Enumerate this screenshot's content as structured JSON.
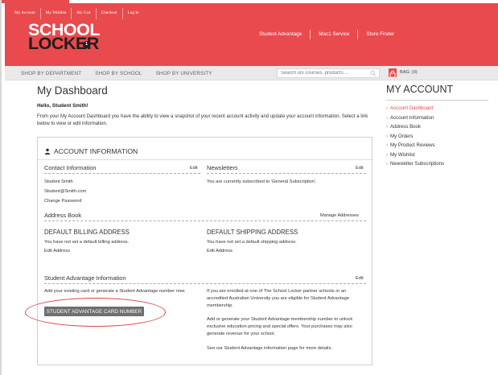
{
  "top_links": [
    "My Account",
    "My Wishlist",
    "My Cart",
    "Checkout",
    "Log In"
  ],
  "logo": {
    "line1": "SCHOOL",
    "line2": "LOCKER"
  },
  "header_nav": [
    "Student Advantage",
    "Mac1 Service",
    "Store Finder"
  ],
  "nav_tabs": [
    "SHOP BY DEPARTMENT",
    "SHOP BY SCHOOL",
    "SHOP BY UNIVERSITY"
  ],
  "search": {
    "placeholder": "Search uni courses, products ..."
  },
  "bag": {
    "label": "BAG: (0)"
  },
  "page": {
    "title": "My Dashboard",
    "greeting": "Hello, Student Smith!",
    "intro": "From your My Account Dashboard you have the ability to view a snapshot of your recent account activity and update your account information. Select a link below to view or edit information."
  },
  "account_info": {
    "heading": "ACCOUNT INFORMATION",
    "contact": {
      "title": "Contact Information",
      "edit": "Edit",
      "name": "Student Smith",
      "email": "Student@Smith.com",
      "change_password": "Change Password"
    },
    "newsletters": {
      "title": "Newsletters",
      "edit": "Edit",
      "text": "You are currently subscribed to 'General Subscription'."
    },
    "address_book": {
      "title": "Address Book",
      "manage": "Manage Addresses",
      "billing_title": "DEFAULT BILLING ADDRESS",
      "billing_text": "You have not set a default billing address.",
      "billing_edit": "Edit Address",
      "shipping_title": "DEFAULT SHIPPING ADDRESS",
      "shipping_text": "You have not set a default shipping address.",
      "shipping_edit": "Edit Address"
    },
    "student_advantage": {
      "title": "Student Advantage Information",
      "edit": "Edit",
      "left_text": "Add your existing card or generate a Student Advantage number now.",
      "button": "STUDENT ADVANTAGE CARD NUMBER",
      "right_p1": "If you are enrolled at one of The School Locker partner schools or an accredited Australian University you are eligible for Student Advantage membership.",
      "right_p2": "Add or generate your Student Advantage membership number to unlock exclusive education pricing and special offers. Your purchases may also generate revenue for your school.",
      "right_p3": "See our Student Advantage information page for more details."
    }
  },
  "sidebar": {
    "title": "MY ACCOUNT",
    "items": [
      {
        "label": "Account Dashboard",
        "active": true
      },
      {
        "label": "Account Information",
        "active": false
      },
      {
        "label": "Address Book",
        "active": false
      },
      {
        "label": "My Orders",
        "active": false
      },
      {
        "label": "My Product Reviews",
        "active": false
      },
      {
        "label": "My Wishlist",
        "active": false
      },
      {
        "label": "Newsletter Subscriptions",
        "active": false
      }
    ]
  },
  "colors": {
    "brand_red": "#e84a4d",
    "annotation_red": "#d94444",
    "button_gray": "#6f6f6f"
  }
}
